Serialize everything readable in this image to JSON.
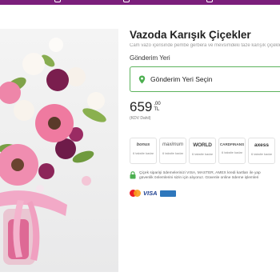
{
  "nav": {
    "items": [
      {
        "icon": "cart-icon"
      },
      {
        "icon": "grid-icon"
      },
      {
        "icon": "gear-icon"
      }
    ]
  },
  "product": {
    "title": "Vazoda Karışık Çiçekler",
    "description": "Cam vazo içerisinde pembe gerbera ve mevsimdeki taze karışık çiçekler",
    "delivery_label": "Gönderim Yeri",
    "delivery_placeholder": "Gönderim Yeri Seçin",
    "price": "659",
    "price_cents": ",00",
    "currency": "TL",
    "vat_note": "(KDV Dahil)"
  },
  "installments": [
    {
      "brand": "bonus",
      "text": "6 taksite kadar"
    },
    {
      "brand": "maximum",
      "text": "6 taksite kadar"
    },
    {
      "brand": "WORLD",
      "text": "6 taksite kadar"
    },
    {
      "brand": "CARDFINANS",
      "text": "6 taksite kadar"
    },
    {
      "brand": "axess",
      "text": "6 taksite kadar"
    }
  ],
  "security": {
    "line1": "Çiçek siparişi ödemelerinizi VISA, MASTER, AMEX kredi kartları ile yap",
    "line2": "güvenlik önlemlerini sizin için alıyoruz. Güvenle online ödeme işlemleri"
  },
  "payment": {
    "visa": "VISA"
  },
  "colors": {
    "brand": "#7b1f7b",
    "accent": "#5db35d"
  }
}
